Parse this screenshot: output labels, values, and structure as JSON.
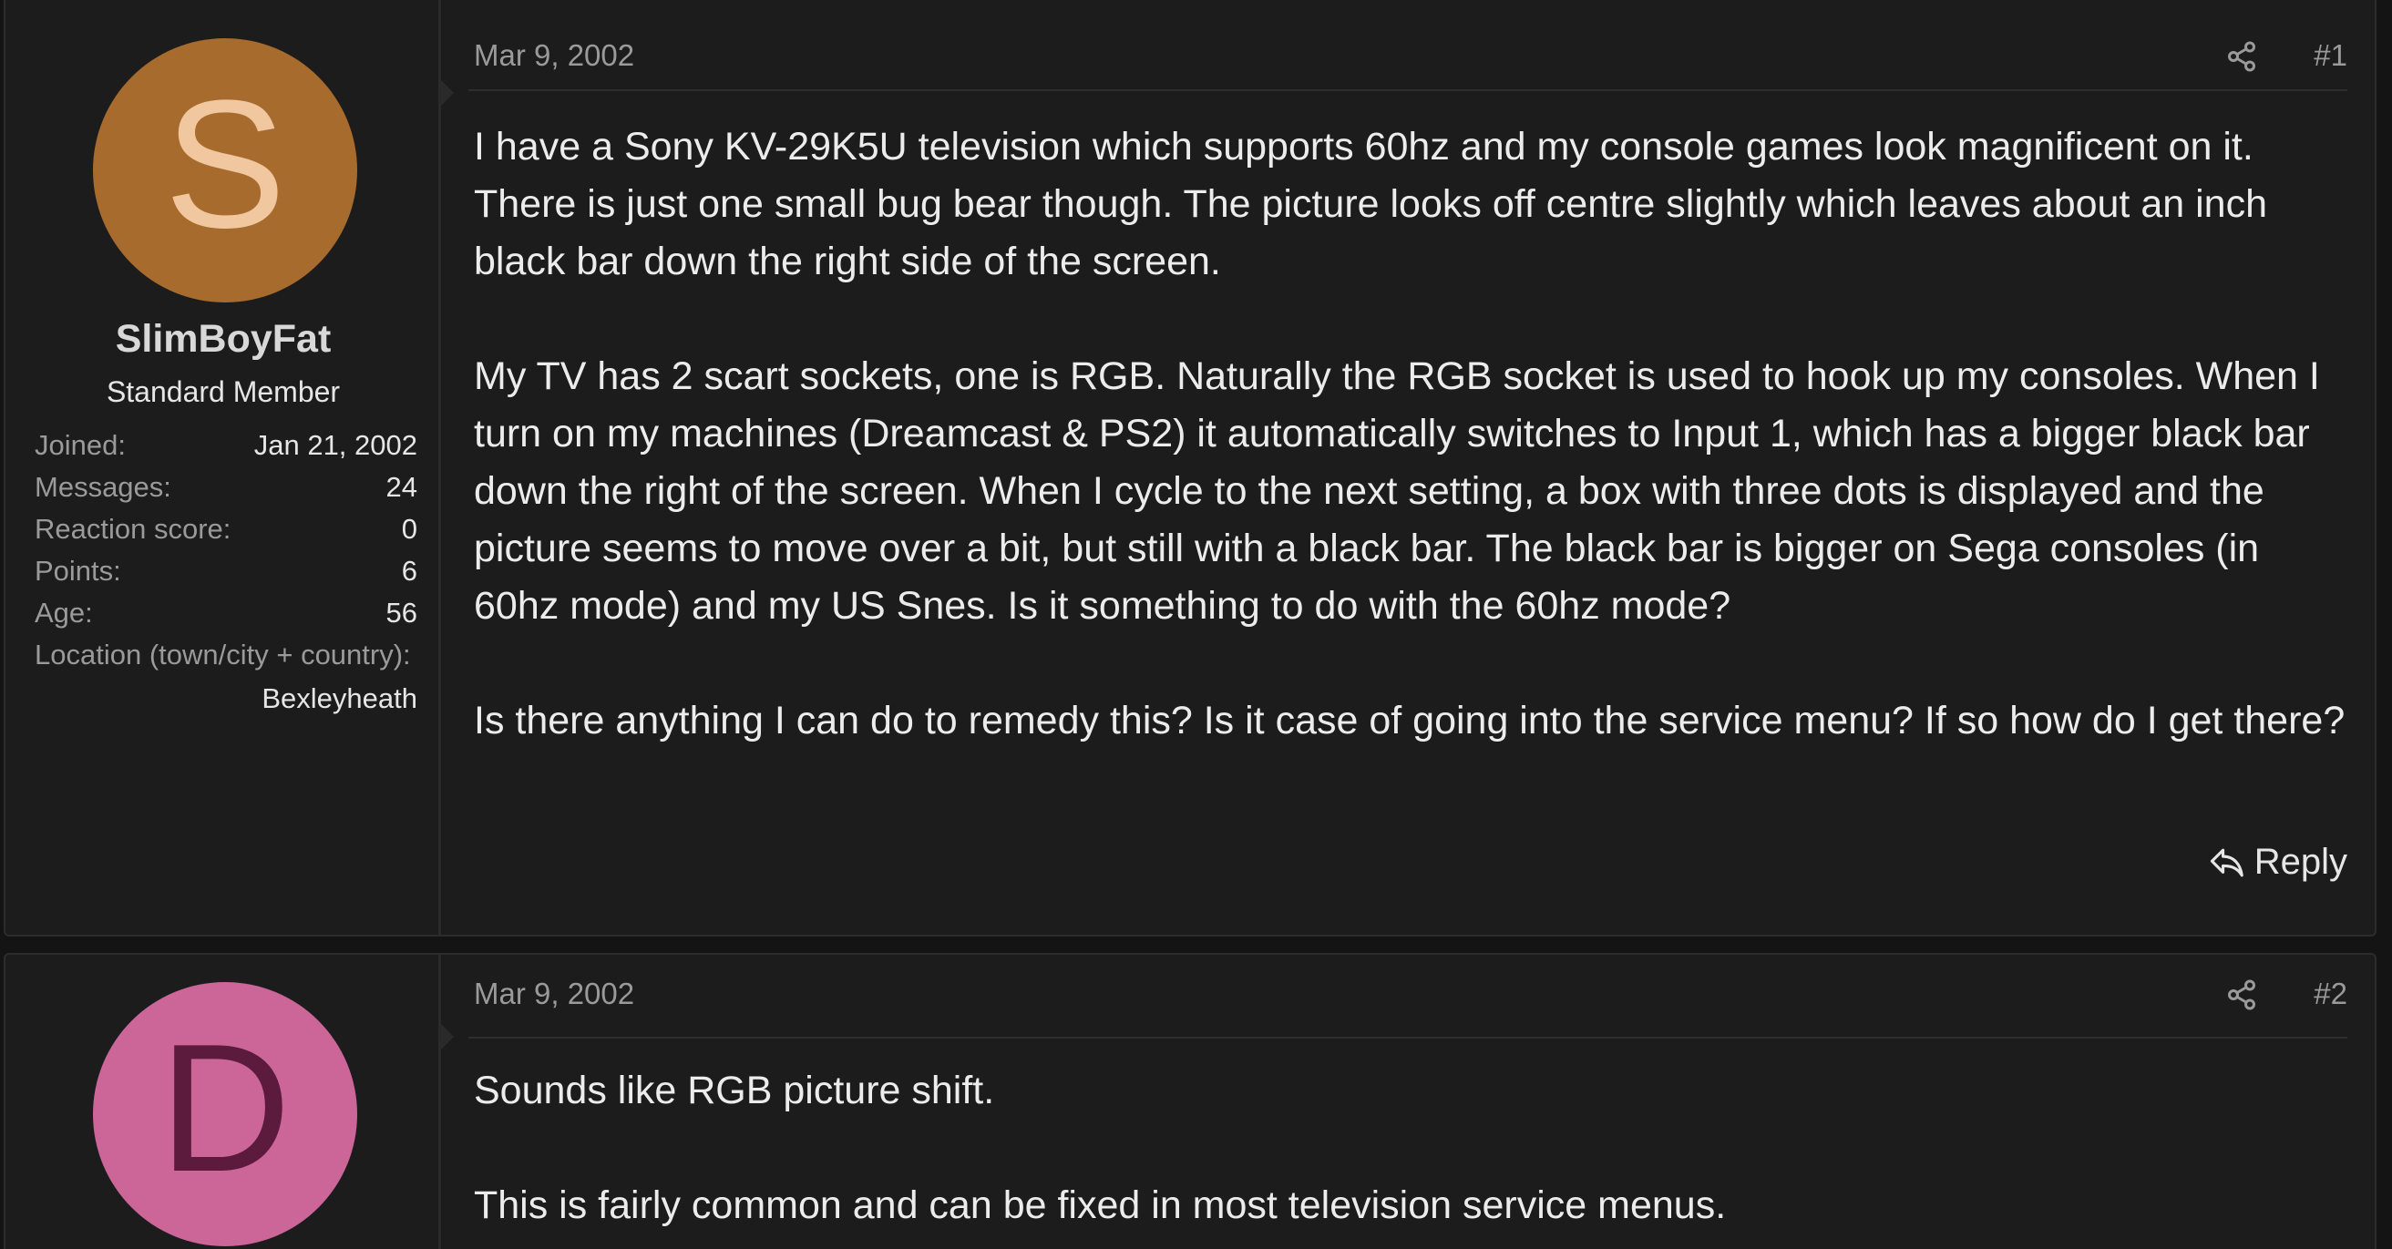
{
  "posts": [
    {
      "user": {
        "avatar_letter": "S",
        "avatar_bg": "#a86b2e",
        "avatar_fg": "#f0c79f",
        "name": "SlimBoyFat",
        "title": "Standard Member",
        "stats": [
          {
            "label": "Joined:",
            "value": "Jan 21, 2002"
          },
          {
            "label": "Messages:",
            "value": "24"
          },
          {
            "label": "Reaction score:",
            "value": "0"
          },
          {
            "label": "Points:",
            "value": "6"
          },
          {
            "label": "Age:",
            "value": "56"
          }
        ],
        "location_label": "Location (town/city + country):",
        "location_value": "Bexleyheath"
      },
      "date": "Mar 9, 2002",
      "number": "#1",
      "paragraphs": [
        "I have a Sony KV-29K5U television which supports 60hz and my console games look magnificent on it. There is just one small bug bear though. The picture looks off centre slightly which leaves about an inch black bar down the right side of the screen.",
        "My TV has 2 scart sockets, one is RGB. Naturally the RGB socket is used to hook up my consoles. When I turn on my machines (Dreamcast & PS2) it automatically switches to Input 1, which has a bigger black bar down the right of the screen. When I cycle to the next setting, a box with three dots is displayed and the picture seems to move over a bit, but still with a black bar. The black bar is bigger on Sega consoles (in 60hz mode) and my US Snes. Is it something to do with the 60hz mode?",
        "Is there anything I can do to remedy this? Is it case of going into the service menu? If so how do I get there?"
      ],
      "reply_label": "Reply",
      "icons": {
        "share": "share-icon",
        "reply": "reply-icon"
      }
    },
    {
      "user": {
        "avatar_letter": "D",
        "avatar_bg": "#cc6699",
        "avatar_fg": "#5c1a3d"
      },
      "date": "Mar 9, 2002",
      "number": "#2",
      "paragraphs": [
        "Sounds like RGB picture shift.",
        "This is fairly common and can be fixed in most television service menus."
      ],
      "icons": {
        "share": "share-icon"
      }
    }
  ]
}
